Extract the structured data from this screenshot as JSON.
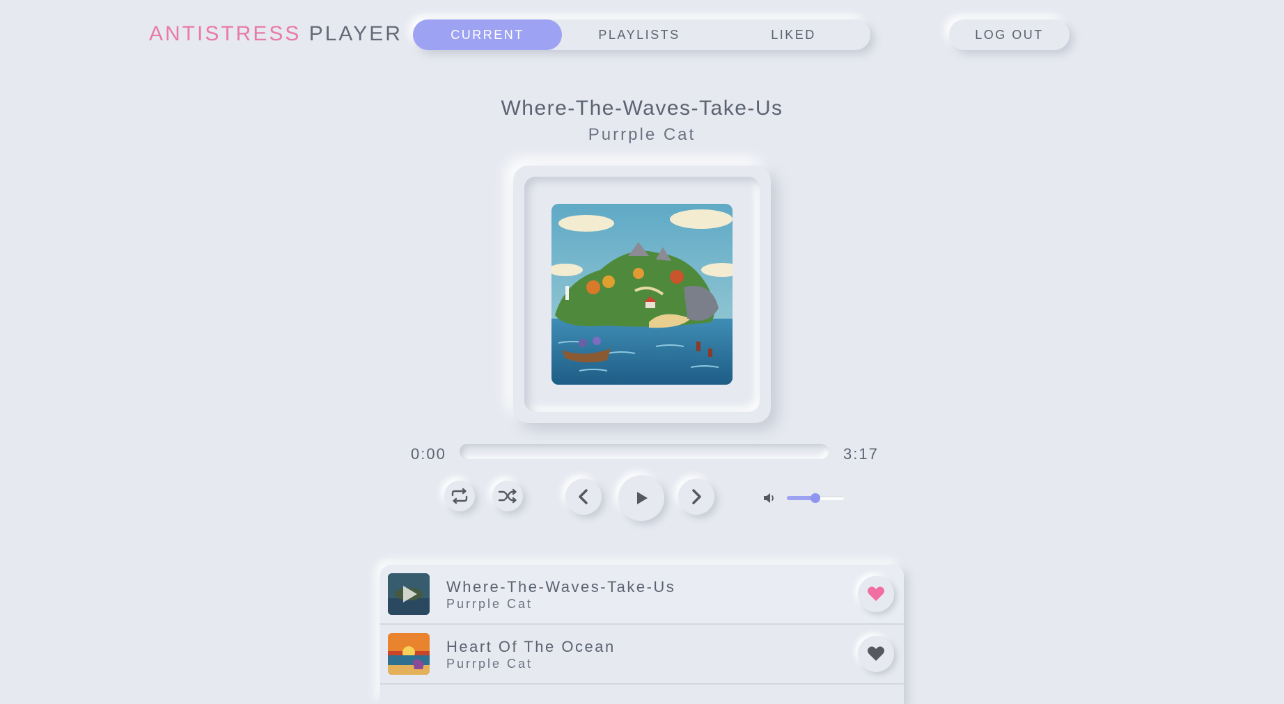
{
  "logo": {
    "part1": "ANTISTRESS",
    "part2": "PLAYER"
  },
  "nav": {
    "tabs": [
      {
        "label": "CURRENT",
        "active": true
      },
      {
        "label": "PLAYLISTS",
        "active": false
      },
      {
        "label": "LIKED",
        "active": false
      }
    ],
    "logout_label": "LOG OUT"
  },
  "now_playing": {
    "title": "Where-The-Waves-Take-Us",
    "artist": "Purrple Cat",
    "current_time": "0:00",
    "duration": "3:17",
    "progress_fraction": 0,
    "volume_fraction": 0.5
  },
  "controls": {
    "repeat_icon": "repeat-icon",
    "shuffle_icon": "shuffle-icon",
    "prev_icon": "chevron-left-icon",
    "play_icon": "play-icon",
    "next_icon": "chevron-right-icon",
    "volume_icon": "volume-icon"
  },
  "playlist": [
    {
      "title": "Where-The-Waves-Take-Us",
      "artist": "Purrple Cat",
      "liked": true,
      "playing": true
    },
    {
      "title": "Heart Of The Ocean",
      "artist": "Purrple Cat",
      "liked": false,
      "playing": false
    }
  ],
  "colors": {
    "accent": "#9da3f2",
    "logo_pink": "#e87aa8",
    "heart_liked": "#f06ea0",
    "heart_default": "#55595f",
    "background": "#e6e9f0"
  }
}
